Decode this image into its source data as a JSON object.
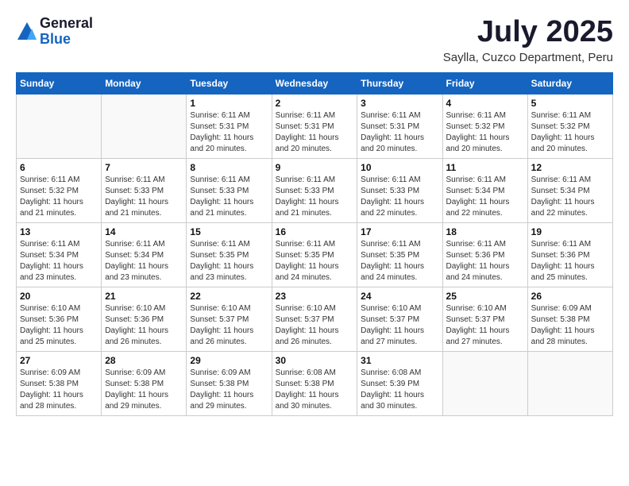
{
  "header": {
    "logo_general": "General",
    "logo_blue": "Blue",
    "title": "July 2025",
    "subtitle": "Saylla, Cuzco Department, Peru"
  },
  "days_of_week": [
    "Sunday",
    "Monday",
    "Tuesday",
    "Wednesday",
    "Thursday",
    "Friday",
    "Saturday"
  ],
  "weeks": [
    [
      {
        "day": "",
        "info": ""
      },
      {
        "day": "",
        "info": ""
      },
      {
        "day": "1",
        "info": "Sunrise: 6:11 AM\nSunset: 5:31 PM\nDaylight: 11 hours and 20 minutes."
      },
      {
        "day": "2",
        "info": "Sunrise: 6:11 AM\nSunset: 5:31 PM\nDaylight: 11 hours and 20 minutes."
      },
      {
        "day": "3",
        "info": "Sunrise: 6:11 AM\nSunset: 5:31 PM\nDaylight: 11 hours and 20 minutes."
      },
      {
        "day": "4",
        "info": "Sunrise: 6:11 AM\nSunset: 5:32 PM\nDaylight: 11 hours and 20 minutes."
      },
      {
        "day": "5",
        "info": "Sunrise: 6:11 AM\nSunset: 5:32 PM\nDaylight: 11 hours and 20 minutes."
      }
    ],
    [
      {
        "day": "6",
        "info": "Sunrise: 6:11 AM\nSunset: 5:32 PM\nDaylight: 11 hours and 21 minutes."
      },
      {
        "day": "7",
        "info": "Sunrise: 6:11 AM\nSunset: 5:33 PM\nDaylight: 11 hours and 21 minutes."
      },
      {
        "day": "8",
        "info": "Sunrise: 6:11 AM\nSunset: 5:33 PM\nDaylight: 11 hours and 21 minutes."
      },
      {
        "day": "9",
        "info": "Sunrise: 6:11 AM\nSunset: 5:33 PM\nDaylight: 11 hours and 21 minutes."
      },
      {
        "day": "10",
        "info": "Sunrise: 6:11 AM\nSunset: 5:33 PM\nDaylight: 11 hours and 22 minutes."
      },
      {
        "day": "11",
        "info": "Sunrise: 6:11 AM\nSunset: 5:34 PM\nDaylight: 11 hours and 22 minutes."
      },
      {
        "day": "12",
        "info": "Sunrise: 6:11 AM\nSunset: 5:34 PM\nDaylight: 11 hours and 22 minutes."
      }
    ],
    [
      {
        "day": "13",
        "info": "Sunrise: 6:11 AM\nSunset: 5:34 PM\nDaylight: 11 hours and 23 minutes."
      },
      {
        "day": "14",
        "info": "Sunrise: 6:11 AM\nSunset: 5:34 PM\nDaylight: 11 hours and 23 minutes."
      },
      {
        "day": "15",
        "info": "Sunrise: 6:11 AM\nSunset: 5:35 PM\nDaylight: 11 hours and 23 minutes."
      },
      {
        "day": "16",
        "info": "Sunrise: 6:11 AM\nSunset: 5:35 PM\nDaylight: 11 hours and 24 minutes."
      },
      {
        "day": "17",
        "info": "Sunrise: 6:11 AM\nSunset: 5:35 PM\nDaylight: 11 hours and 24 minutes."
      },
      {
        "day": "18",
        "info": "Sunrise: 6:11 AM\nSunset: 5:36 PM\nDaylight: 11 hours and 24 minutes."
      },
      {
        "day": "19",
        "info": "Sunrise: 6:11 AM\nSunset: 5:36 PM\nDaylight: 11 hours and 25 minutes."
      }
    ],
    [
      {
        "day": "20",
        "info": "Sunrise: 6:10 AM\nSunset: 5:36 PM\nDaylight: 11 hours and 25 minutes."
      },
      {
        "day": "21",
        "info": "Sunrise: 6:10 AM\nSunset: 5:36 PM\nDaylight: 11 hours and 26 minutes."
      },
      {
        "day": "22",
        "info": "Sunrise: 6:10 AM\nSunset: 5:37 PM\nDaylight: 11 hours and 26 minutes."
      },
      {
        "day": "23",
        "info": "Sunrise: 6:10 AM\nSunset: 5:37 PM\nDaylight: 11 hours and 26 minutes."
      },
      {
        "day": "24",
        "info": "Sunrise: 6:10 AM\nSunset: 5:37 PM\nDaylight: 11 hours and 27 minutes."
      },
      {
        "day": "25",
        "info": "Sunrise: 6:10 AM\nSunset: 5:37 PM\nDaylight: 11 hours and 27 minutes."
      },
      {
        "day": "26",
        "info": "Sunrise: 6:09 AM\nSunset: 5:38 PM\nDaylight: 11 hours and 28 minutes."
      }
    ],
    [
      {
        "day": "27",
        "info": "Sunrise: 6:09 AM\nSunset: 5:38 PM\nDaylight: 11 hours and 28 minutes."
      },
      {
        "day": "28",
        "info": "Sunrise: 6:09 AM\nSunset: 5:38 PM\nDaylight: 11 hours and 29 minutes."
      },
      {
        "day": "29",
        "info": "Sunrise: 6:09 AM\nSunset: 5:38 PM\nDaylight: 11 hours and 29 minutes."
      },
      {
        "day": "30",
        "info": "Sunrise: 6:08 AM\nSunset: 5:38 PM\nDaylight: 11 hours and 30 minutes."
      },
      {
        "day": "31",
        "info": "Sunrise: 6:08 AM\nSunset: 5:39 PM\nDaylight: 11 hours and 30 minutes."
      },
      {
        "day": "",
        "info": ""
      },
      {
        "day": "",
        "info": ""
      }
    ]
  ]
}
